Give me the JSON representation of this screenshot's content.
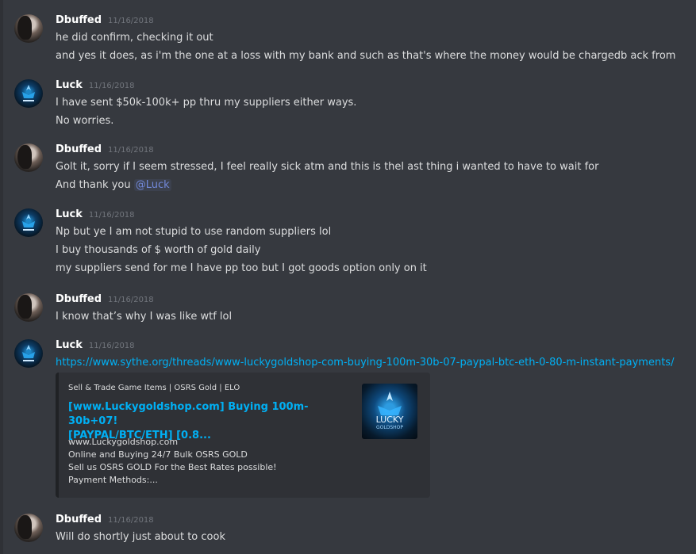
{
  "messages": [
    {
      "author": "Dbuffed",
      "timestamp": "11/16/2018",
      "avatar_icon": "user-avatar-dbuffed",
      "lines": [
        "he did confirm, checking it out",
        "and yes it does, as i'm the one at a loss with my bank and such as that's where the money would be chargedb ack from"
      ]
    },
    {
      "author": "Luck",
      "timestamp": "11/16/2018",
      "avatar_icon": "user-avatar-luck",
      "lines": [
        "I have sent $50k-100k+ pp thru my suppliers either ways.",
        "No worries."
      ]
    },
    {
      "author": "Dbuffed",
      "timestamp": "11/16/2018",
      "avatar_icon": "user-avatar-dbuffed",
      "lines": [
        "Golt it, sorry if I seem stressed, I feel really sick atm and this is thel ast thing i wanted to have to wait for"
      ],
      "line_with_mention": {
        "text": "And thank you ",
        "mention": "@Luck"
      }
    },
    {
      "author": "Luck",
      "timestamp": "11/16/2018",
      "avatar_icon": "user-avatar-luck",
      "lines": [
        "Np but ye I am not stupid to use random suppliers lol",
        "I buy thousands of $ worth of gold daily",
        "my suppliers send for me I have pp too but I got goods option only on it"
      ]
    },
    {
      "author": "Dbuffed",
      "timestamp": "11/16/2018",
      "avatar_icon": "user-avatar-dbuffed",
      "lines": [
        "I know that’s why I was like wtf lol"
      ]
    },
    {
      "author": "Luck",
      "timestamp": "11/16/2018",
      "avatar_icon": "user-avatar-luck",
      "link": "https://www.sythe.org/threads/www-luckygoldshop-com-buying-100m-30b-07-paypal-btc-eth-0-80-m-instant-payments/",
      "embed": {
        "provider": "Sell & Trade Game Items | OSRS Gold | ELO",
        "title_line1": "[www.Luckygoldshop.com] Buying 100m-30b+07!",
        "title_line2": "[PAYPAL/BTC/ETH] [0.8...",
        "description": "www.Luckygoldshop.com\nOnline and Buying 24/7 Bulk OSRS GOLD\nSell us OSRS GOLD For the Best Rates possible!\nPayment Methods:...",
        "thumbnail_text": "LUCKY",
        "thumbnail_subtext": "GOLDSHOP"
      }
    },
    {
      "author": "Dbuffed",
      "timestamp": "11/16/2018",
      "avatar_icon": "user-avatar-dbuffed",
      "lines": [
        "Will do shortly just about to cook"
      ]
    }
  ],
  "colors": {
    "background": "#36393f",
    "text": "#dcddde",
    "author": "#ffffff",
    "timestamp": "#72767d",
    "link": "#00b0f4",
    "mention": "#7289da",
    "embed_bg": "#2f3136"
  }
}
